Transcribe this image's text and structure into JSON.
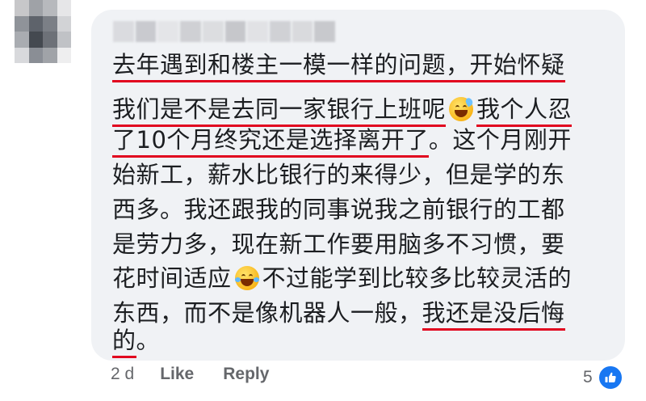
{
  "comment": {
    "lines": [
      [
        "",
        "去年遇到和楼主一模一样的问题，开始怀疑",
        ""
      ],
      [
        "",
        "我们是不是去同一家银行上班呢",
        " 😅 ",
        "我个人忍"
      ],
      [
        "",
        "了10个月终究还是选择离开了",
        "。这个月刚开"
      ],
      [
        "始新工，薪水比银行的来得少，但是学的东"
      ],
      [
        "西多。我还跟我的同事说我之前银行的工都"
      ],
      [
        "是劳力多，现在新工作要用脑多不习惯，要"
      ],
      [
        "花时间适应",
        "😂",
        "不过能学到比较多比较灵活的"
      ],
      [
        "东西，而不是像机器人一般，",
        "我还是没后悔"
      ],
      [
        "的",
        "。"
      ]
    ],
    "emoji_1": "grinning-face-with-sweat",
    "emoji_2": "face-with-tears-of-joy"
  },
  "footer": {
    "time": "2 d",
    "like_label": "Like",
    "reply_label": "Reply",
    "reaction_count": "5",
    "reaction_icon": "thumbs-up-icon"
  },
  "colors": {
    "bubble": "#f0f2f5",
    "text": "#1c1e21",
    "underline": "#e1051f",
    "meta": "#65676b",
    "like_blue": "#1877f2"
  }
}
